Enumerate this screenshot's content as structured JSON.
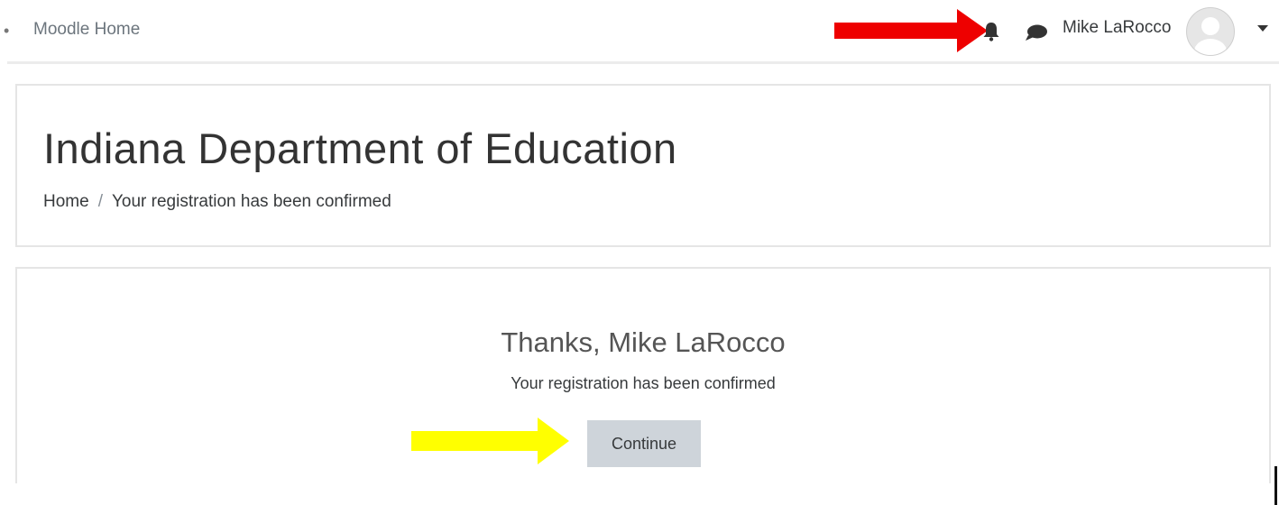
{
  "navbar": {
    "brand": "Moodle Home",
    "edge_glyph": "•",
    "icons": {
      "notifications": "bell-icon",
      "messages": "chat-icon",
      "menu": "caret-down-icon"
    },
    "user_name": "Mike LaRocco"
  },
  "header": {
    "site_title": "Indiana Department of Education",
    "breadcrumb": {
      "home": "Home",
      "separator": "/",
      "current": "Your registration has been confirmed"
    }
  },
  "main": {
    "thanks": "Thanks, Mike LaRocco",
    "message": "Your registration has been confirmed",
    "continue_label": "Continue"
  },
  "annotations": {
    "red_arrow_color": "#ee0000",
    "yellow_arrow_color": "#ffff00"
  }
}
